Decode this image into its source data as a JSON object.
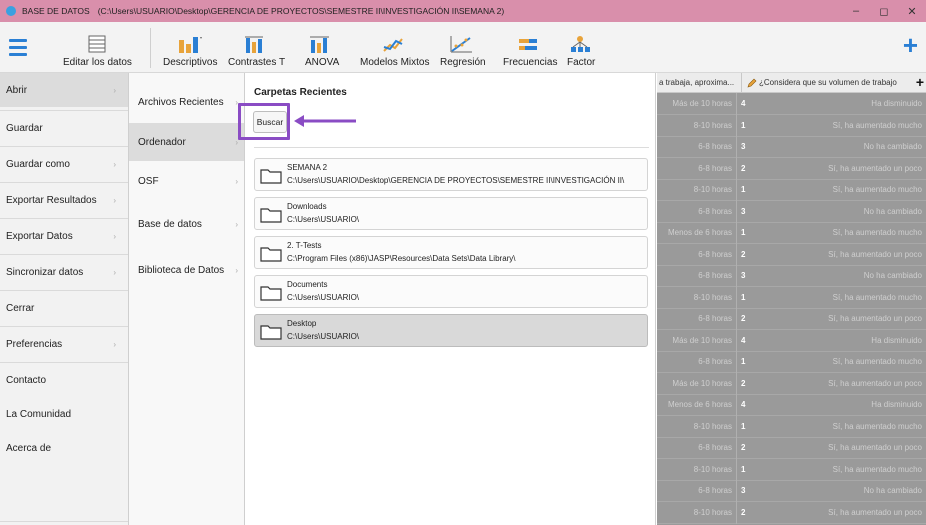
{
  "titlebar": {
    "app_name": "BASE DE DATOS",
    "path": "(C:\\Users\\USUARIO\\Desktop\\GERENCIA DE PROYECTOS\\SEMESTRE II\\INVESTIGACIÓN II\\SEMANA 2)",
    "minimize": "–",
    "maximize": "◻",
    "close": "✕"
  },
  "ribbon": {
    "edit_data": "Editar los datos",
    "descriptives": "Descriptivos",
    "t_tests": "Contrastes T",
    "anova": "ANOVA",
    "mixed_models": "Modelos Mixtos",
    "regression": "Regresión",
    "frequencies": "Frecuencias",
    "factor": "Factor",
    "add": "+"
  },
  "menu": {
    "items": [
      {
        "label": "Abrir",
        "chevron": "›"
      },
      {
        "label": "Guardar",
        "chevron": ""
      },
      {
        "label": "Guardar como",
        "chevron": "›"
      },
      {
        "label": "Exportar Resultados",
        "chevron": "›"
      },
      {
        "label": "Exportar Datos",
        "chevron": "›"
      },
      {
        "label": "Sincronizar datos",
        "chevron": "›"
      },
      {
        "label": "Cerrar",
        "chevron": ""
      },
      {
        "label": "Preferencias",
        "chevron": "›"
      },
      {
        "label": "Contacto",
        "chevron": ""
      },
      {
        "label": "La Comunidad",
        "chevron": ""
      },
      {
        "label": "Acerca de",
        "chevron": ""
      }
    ]
  },
  "submenu": {
    "items": [
      {
        "label": "Archivos Recientes",
        "chevron": "›"
      },
      {
        "label": "Ordenador",
        "chevron": "›"
      },
      {
        "label": "OSF",
        "chevron": "›"
      },
      {
        "label": "Base de datos",
        "chevron": "›"
      },
      {
        "label": "Biblioteca de Datos",
        "chevron": "›"
      }
    ]
  },
  "panel": {
    "heading": "Carpetas Recientes",
    "search_button": "Buscar",
    "folders": [
      {
        "name": "SEMANA 2",
        "path": "C:\\Users\\USUARIO\\Desktop\\GERENCIA DE PROYECTOS\\SEMESTRE II\\INVESTIGACIÓN II\\"
      },
      {
        "name": "Downloads",
        "path": "C:\\Users\\USUARIO\\"
      },
      {
        "name": "2. T-Tests",
        "path": "C:\\Program Files (x86)\\JASP\\Resources\\Data Sets\\Data Library\\"
      },
      {
        "name": "Documents",
        "path": "C:\\Users\\USUARIO\\"
      },
      {
        "name": "Desktop",
        "path": "C:\\Users\\USUARIO\\"
      }
    ]
  },
  "grid": {
    "header_col1": "a trabaja, aproxima...",
    "header_col2": "¿Considera que su volumen de trabajo",
    "header_plus": "+",
    "rows": [
      [
        "Más de 10 horas",
        "4",
        "Ha disminuido"
      ],
      [
        "8-10 horas",
        "1",
        "Sí, ha aumentado mucho"
      ],
      [
        "6-8 horas",
        "3",
        "No ha cambiado"
      ],
      [
        "6-8 horas",
        "2",
        "Sí, ha aumentado un poco"
      ],
      [
        "8-10 horas",
        "1",
        "Sí, ha aumentado mucho"
      ],
      [
        "6-8 horas",
        "3",
        "No ha cambiado"
      ],
      [
        "Menos de 6 horas",
        "1",
        "Sí, ha aumentado mucho"
      ],
      [
        "6-8 horas",
        "2",
        "Sí, ha aumentado un poco"
      ],
      [
        "6-8 horas",
        "3",
        "No ha cambiado"
      ],
      [
        "8-10 horas",
        "1",
        "Sí, ha aumentado mucho"
      ],
      [
        "6-8 horas",
        "2",
        "Sí, ha aumentado un poco"
      ],
      [
        "Más de 10 horas",
        "4",
        "Ha disminuido"
      ],
      [
        "6-8 horas",
        "1",
        "Sí, ha aumentado mucho"
      ],
      [
        "Más de 10 horas",
        "2",
        "Sí, ha aumentado un poco"
      ],
      [
        "Menos de 6 horas",
        "4",
        "Ha disminuido"
      ],
      [
        "8-10 horas",
        "1",
        "Sí, ha aumentado mucho"
      ],
      [
        "6-8 horas",
        "2",
        "Sí, ha aumentado un poco"
      ],
      [
        "8-10 horas",
        "1",
        "Sí, ha aumentado mucho"
      ],
      [
        "6-8 horas",
        "3",
        "No ha cambiado"
      ],
      [
        "8-10 horas",
        "2",
        "Sí, ha aumentado un poco"
      ]
    ]
  },
  "colors": {
    "titlebar": "#d98fab",
    "accent": "#2a7fd4",
    "highlight": "#8a4cc4"
  }
}
